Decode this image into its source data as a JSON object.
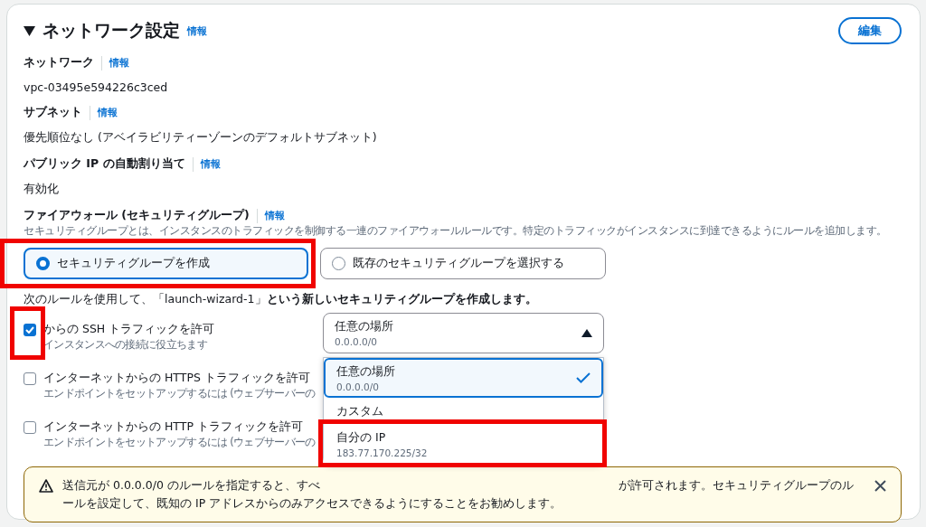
{
  "section": {
    "title": "ネットワーク設定",
    "info_link": "情報",
    "expanded": true,
    "edit_button": "編集"
  },
  "fields": [
    {
      "label": "ネットワーク",
      "info_link": "情報",
      "value": "vpc-03495e594226c3ced"
    },
    {
      "label": "サブネット",
      "info_link": "情報",
      "value": "優先順位なし (アベイラビリティーゾーンのデフォルトサブネット)"
    },
    {
      "label": "パブリック IP の自動割り当て",
      "info_link": "情報",
      "value": "有効化"
    }
  ],
  "firewall": {
    "label": "ファイアウォール (セキュリティグループ)",
    "info_link": "情報",
    "description": "セキュリティグループとは、インスタンスのトラフィックを制御する一連のファイアウォールルールです。特定のトラフィックがインスタンスに到達できるようにルールを追加します。",
    "options": [
      {
        "label": "セキュリティグループを作成",
        "selected": true,
        "highlighted": true
      },
      {
        "label": "既存のセキュリティグループを選択する",
        "selected": false,
        "highlighted": false
      }
    ],
    "rule_note": "次のルールを使用して、「launch-wizard-1」**という新しいセキュリティグループを作成します。**",
    "rules": [
      {
        "label": "からの SSH トラフィックを許可",
        "description": "インスタンスへの接続に役立ちます",
        "checked": true,
        "highlighted": true
      },
      {
        "label": "インターネットからの HTTPS トラフィックを許可",
        "description": "エンドポイントをセットアップするには (ウェブサーバーの",
        "checked": false,
        "highlighted": false
      },
      {
        "label": "インターネットからの HTTP トラフィックを許可",
        "description": "エンドポイントをセットアップするには (ウェブサーバーの",
        "checked": false,
        "highlighted": false
      }
    ]
  },
  "source_select": {
    "value": "任意の場所",
    "detail": "0.0.0.0/0",
    "expanded": true,
    "options": [
      {
        "label": "任意の場所",
        "detail": "0.0.0.0/0",
        "selected": true,
        "highlighted": false
      },
      {
        "label": "カスタム",
        "selected": false,
        "highlighted": false
      },
      {
        "label": "自分の IP",
        "detail": "183.77.170.225/32",
        "selected": false,
        "highlighted": true
      }
    ]
  },
  "alert": {
    "text_start": "送信元が 0.0.0.0/0 のルールを指定すると、すべ",
    "text_after_menu": "が許可されます。セキュリティグループのル",
    "text_line_2": "ールを設定して、既知の IP アドレスからのみアクセスできるようにすることをお勧めします。"
  }
}
